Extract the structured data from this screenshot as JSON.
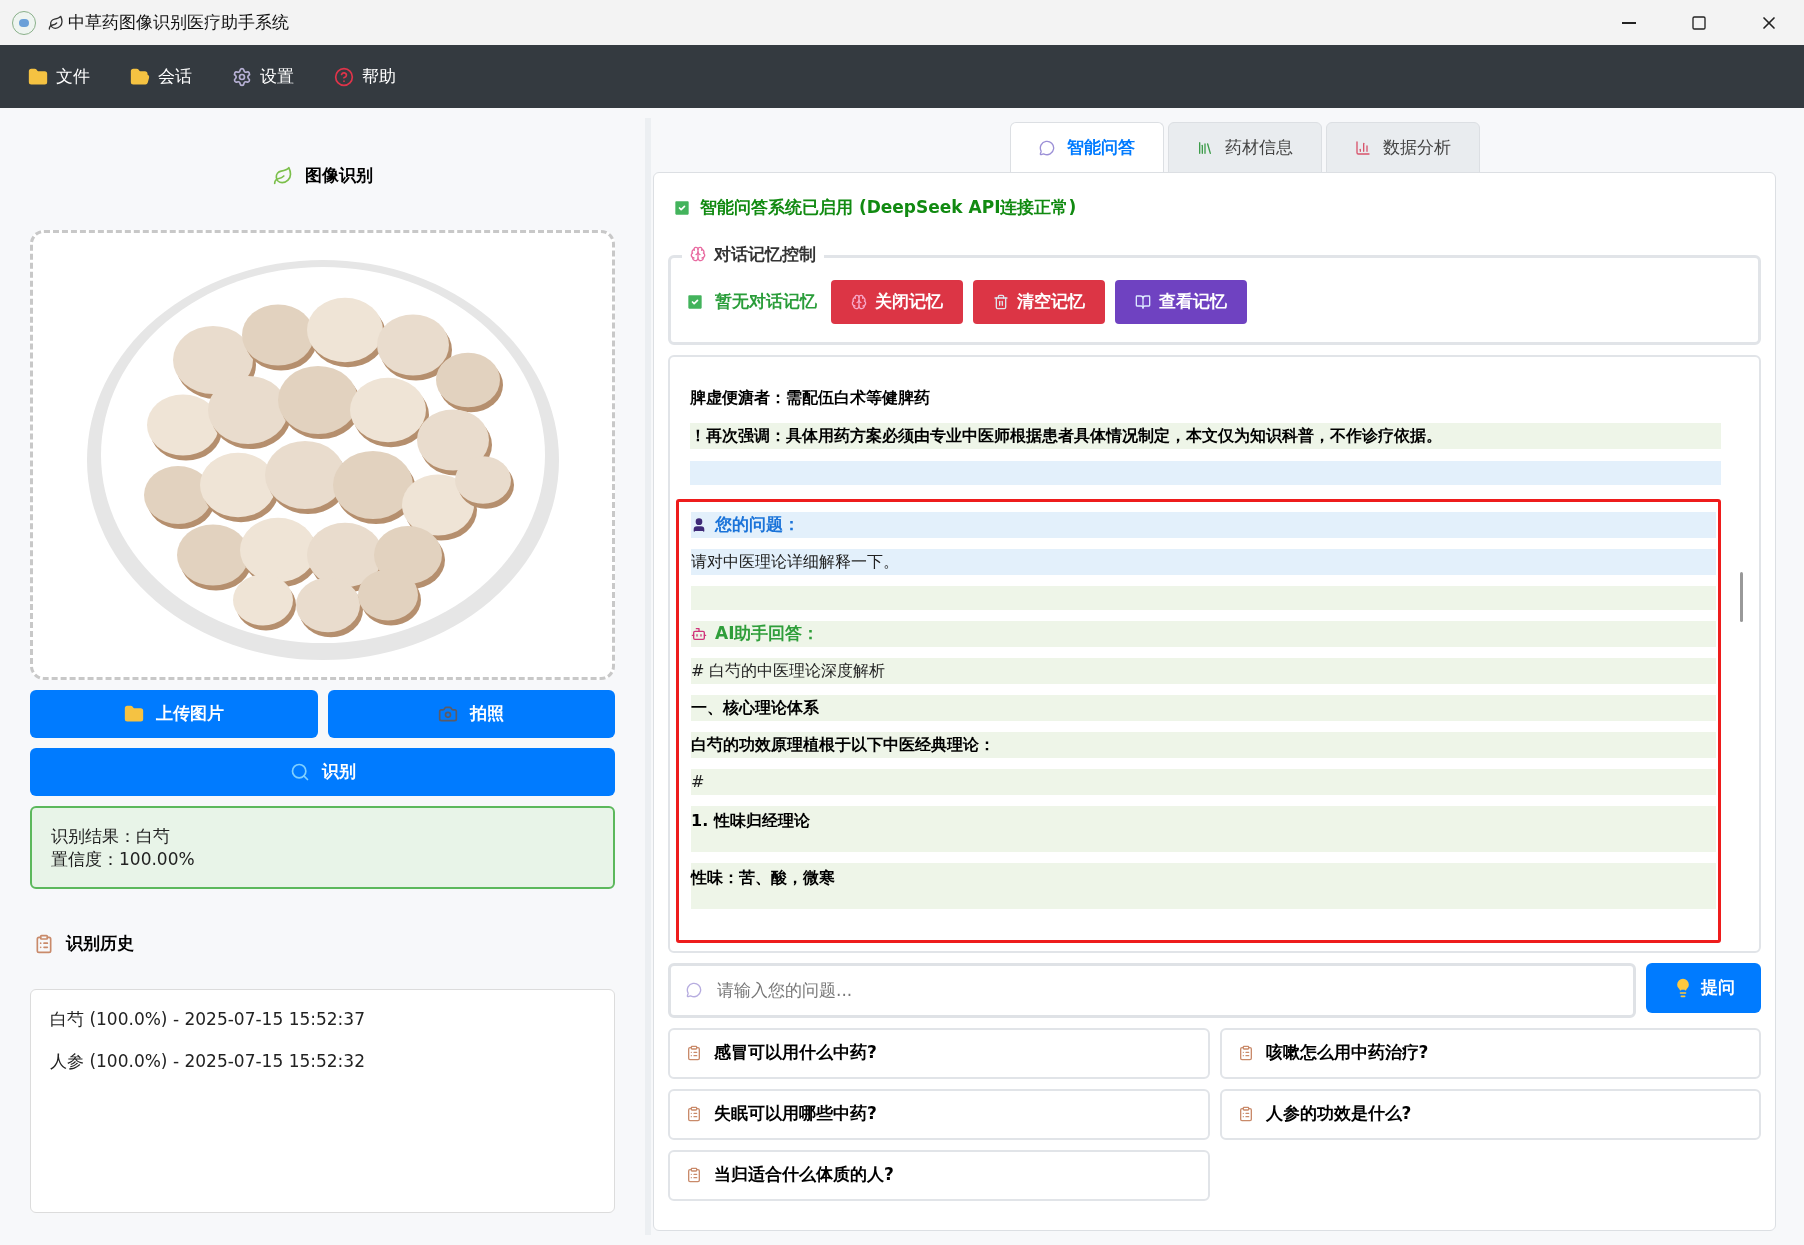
{
  "window": {
    "title": "中草药图像识别医疗助手系统"
  },
  "menu": [
    "文件",
    "会话",
    "设置",
    "帮助"
  ],
  "left": {
    "heading": "图像识别",
    "image": {
      "kind": "picture"
    },
    "buttons": [
      "上传图片",
      "拍照"
    ],
    "recognize_button": {
      "label": "识别"
    },
    "result": [
      "识别结果：白芍",
      "置信度：100.00%"
    ],
    "history": {
      "heading": "识别历史",
      "items": [
        "白芍 (100.0%) - 2025-07-15 15:52:37",
        "人参 (100.0%) - 2025-07-15 15:52:32"
      ]
    }
  },
  "tabs": [
    {
      "label": "智能问答",
      "selected": true
    },
    {
      "label": "药材信息",
      "selected": false
    },
    {
      "label": "数据分析",
      "selected": false
    }
  ],
  "status": "智能问答系统已启用 (DeepSeek API连接正常)",
  "memory": {
    "title": "对话记忆控制",
    "state": "暂无对话记忆",
    "buttons": [
      {
        "label": "关闭记忆",
        "color": "#dc3545"
      },
      {
        "label": "清空记忆",
        "color": "#dc3545"
      },
      {
        "label": "查看记忆",
        "color": "#6f42c1"
      }
    ]
  },
  "chat": {
    "earlier": [
      {
        "kind": "bold",
        "text": "脾虚便溏者：需配伍白术等健脾药"
      },
      {
        "kind": "ai_bold",
        "text": "！再次强调：具体用药方案必须由专业中医师根据患者具体情况制定，本文仅为知识科普，不作诊疗依据。"
      },
      {
        "kind": "user_gap"
      }
    ],
    "exchange": {
      "outlined": true,
      "lines": [
        {
          "kind": "user_label",
          "text": "您的问题："
        },
        {
          "kind": "user_text",
          "text": "请对中医理论详细解释一下。"
        },
        {
          "kind": "ai_gap"
        },
        {
          "kind": "ai_label",
          "text": "AI助手回答："
        },
        {
          "kind": "ai_text",
          "text": "# 白芍的中医理论深度解析"
        },
        {
          "kind": "ai_bold",
          "text": "一、核心理论体系"
        },
        {
          "kind": "ai_bold",
          "text": "白芍的功效原理植根于以下中医经典理论："
        },
        {
          "kind": "ai_text",
          "text": "#"
        },
        {
          "kind": "ai_tall",
          "text": "1. 性味归经理论"
        },
        {
          "kind": "ai_tall",
          "text": "性味：苦、酸，微寒"
        }
      ]
    }
  },
  "input": {
    "placeholder": "请输入您的问题...",
    "button": "提问"
  },
  "quick_questions": [
    "感冒可以用什么中药?",
    "咳嗽怎么用中药治疗?",
    "失眠可以用哪些中药?",
    "人参的功效是什么?",
    "当归适合什么体质的人?"
  ]
}
